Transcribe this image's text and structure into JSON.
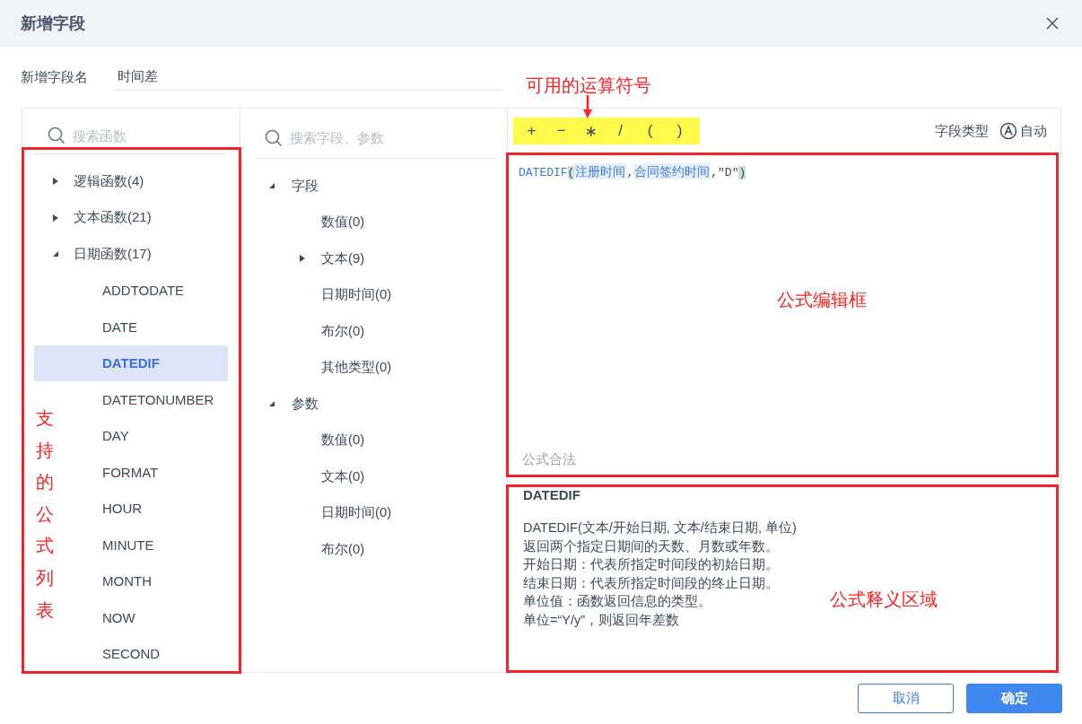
{
  "dialog": {
    "title": "新增字段"
  },
  "name_field": {
    "label": "新增字段名",
    "value": "时间差"
  },
  "function_panel": {
    "search_placeholder": "搜索函数",
    "groups": [
      {
        "label": "逻辑函数(4)",
        "expanded": false
      },
      {
        "label": "文本函数(21)",
        "expanded": false
      },
      {
        "label": "日期函数(17)",
        "expanded": true,
        "children": [
          {
            "label": "ADDTODATE",
            "selected": false
          },
          {
            "label": "DATE",
            "selected": false
          },
          {
            "label": "DATEDIF",
            "selected": true
          },
          {
            "label": "DATETONUMBER",
            "selected": false
          },
          {
            "label": "DAY",
            "selected": false
          },
          {
            "label": "FORMAT",
            "selected": false
          },
          {
            "label": "HOUR",
            "selected": false
          },
          {
            "label": "MINUTE",
            "selected": false
          },
          {
            "label": "MONTH",
            "selected": false
          },
          {
            "label": "NOW",
            "selected": false
          },
          {
            "label": "SECOND",
            "selected": false
          }
        ]
      }
    ]
  },
  "field_panel": {
    "search_placeholder": "搜索字段、参数",
    "groups": [
      {
        "label": "字段",
        "expanded": true,
        "children": [
          {
            "label": "数值(0)",
            "kind": "leaf"
          },
          {
            "label": "文本(9)",
            "kind": "folder",
            "expanded": false
          },
          {
            "label": "日期时间(0)",
            "kind": "leaf"
          },
          {
            "label": "布尔(0)",
            "kind": "leaf"
          },
          {
            "label": "其他类型(0)",
            "kind": "leaf"
          }
        ]
      },
      {
        "label": "参数",
        "expanded": true,
        "children": [
          {
            "label": "数值(0)",
            "kind": "leaf"
          },
          {
            "label": "文本(0)",
            "kind": "leaf"
          },
          {
            "label": "日期时间(0)",
            "kind": "leaf"
          },
          {
            "label": "布尔(0)",
            "kind": "leaf"
          }
        ]
      }
    ]
  },
  "operators": [
    "+",
    "−",
    "∗",
    "/",
    "(",
    ")"
  ],
  "field_type": {
    "label": "字段类型",
    "value": "自动"
  },
  "formula": [
    {
      "text": "DATEDIF",
      "kind": "function"
    },
    {
      "text": "(",
      "kind": "bracket"
    },
    {
      "text": "注册时间",
      "kind": "field"
    },
    {
      "text": ",",
      "kind": "plain"
    },
    {
      "text": "合同签约时间",
      "kind": "field"
    },
    {
      "text": ",\"D\"",
      "kind": "plain"
    },
    {
      "text": ")",
      "kind": "bracket"
    }
  ],
  "formula_status": "公式合法",
  "description": {
    "title": "DATEDIF",
    "lines": [
      "DATEDIF(文本/开始日期, 文本/结束日期, 单位)",
      "返回两个指定日期间的天数、月数或年数。",
      "开始日期：代表所指定时间段的初始日期。",
      "结束日期：代表所指定时间段的终止日期。",
      "单位值：函数返回信息的类型。",
      "单位=“Y/y”，则返回年差数"
    ]
  },
  "buttons": [
    {
      "label": "取消",
      "kind": "secondary"
    },
    {
      "label": "确定",
      "kind": "primary"
    }
  ],
  "annotations": {
    "operators": "可用的运算符号",
    "function_list": "支持的公式列表",
    "editor": "公式编辑框",
    "description": "公式释义区域"
  }
}
